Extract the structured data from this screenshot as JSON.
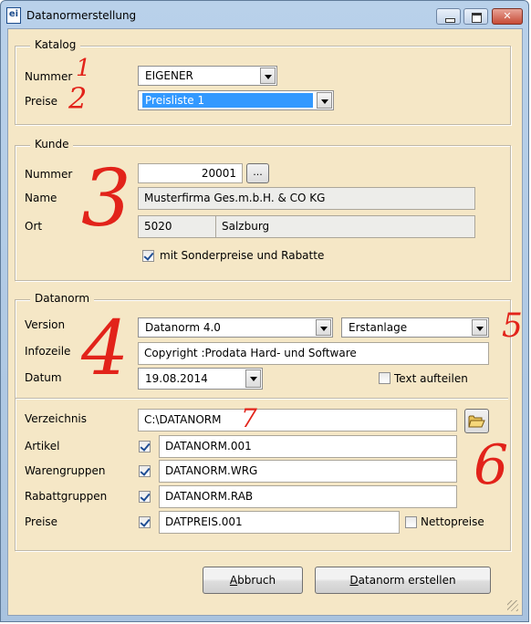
{
  "window": {
    "title": "Datanormerstellung",
    "app_icon": "ei"
  },
  "katalog": {
    "legend": "Katalog",
    "nummer_label": "Nummer",
    "nummer_value": "EIGENER",
    "preise_label": "Preise",
    "preise_value": "Preisliste 1"
  },
  "kunde": {
    "legend": "Kunde",
    "nummer_label": "Nummer",
    "nummer_value": "20001",
    "browse_label": "...",
    "name_label": "Name",
    "name_value": "Musterfirma Ges.m.b.H. & CO KG",
    "ort_label": "Ort",
    "plz_value": "5020",
    "ort_value": "Salzburg",
    "sonderpreise_label": "mit Sonderpreise und Rabatte",
    "sonderpreise_checked": true
  },
  "datanorm": {
    "legend": "Datanorm",
    "version_label": "Version",
    "version_value": "Datanorm 4.0",
    "art_value": "Erstanlage",
    "infozeile_label": "Infozeile",
    "infozeile_value": "Copyright :Prodata Hard- und Software",
    "datum_label": "Datum",
    "datum_value": "19.08.2014",
    "text_aufteilen_label": "Text aufteilen",
    "text_aufteilen_checked": false,
    "verzeichnis_label": "Verzeichnis",
    "verzeichnis_value": "C:\\DATANORM",
    "artikel_label": "Artikel",
    "artikel_value": "DATANORM.001",
    "warengruppen_label": "Warengruppen",
    "warengruppen_value": "DATANORM.WRG",
    "rabattgruppen_label": "Rabattgruppen",
    "rabattgruppen_value": "DATANORM.RAB",
    "preise_label": "Preise",
    "preise_value": "DATPREIS.001",
    "nettopreise_label": "Nettopreise",
    "nettopreise_checked": false
  },
  "buttons": {
    "abbruch_first": "A",
    "abbruch_rest": "bbruch",
    "erstellen_first": "D",
    "erstellen_rest": "atanorm erstellen"
  },
  "annotations": [
    "1",
    "2",
    "3",
    "4",
    "5",
    "6",
    "7"
  ],
  "colors": {
    "panel": "#f5e7c6",
    "annotation": "#e2231a",
    "selection": "#3399ff",
    "title_bar": "#b9d1ea"
  }
}
